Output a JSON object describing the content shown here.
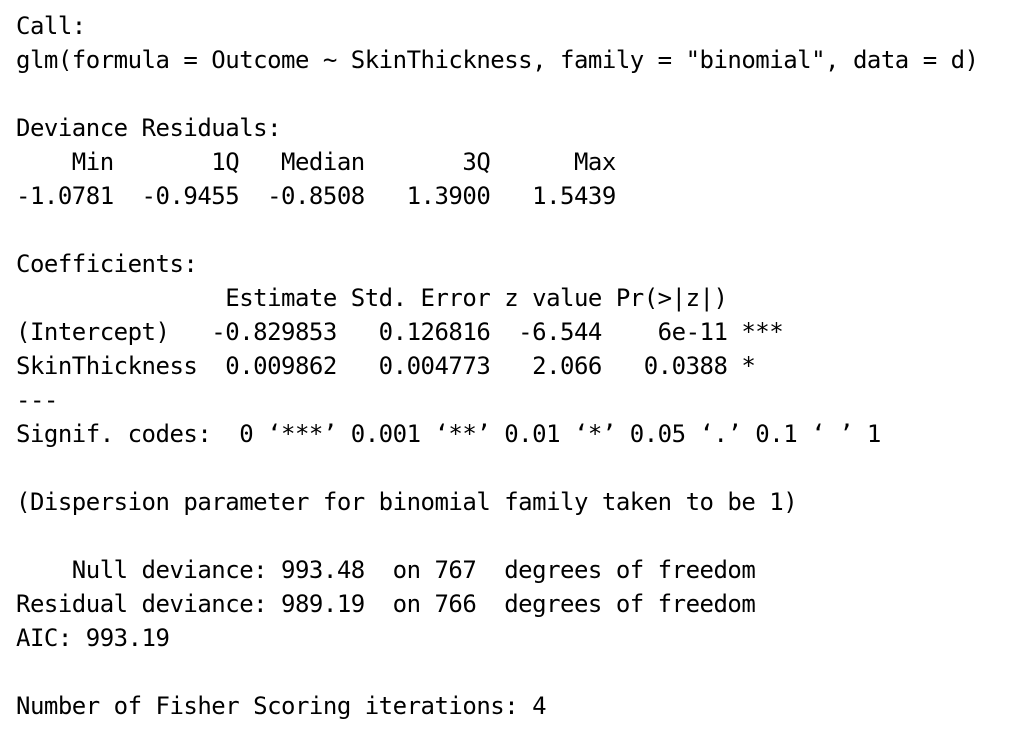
{
  "output_lines": [
    "Call:",
    "glm(formula = Outcome ~ SkinThickness, family = \"binomial\", data = d)",
    "",
    "Deviance Residuals:",
    "    Min       1Q   Median       3Q      Max  ",
    "-1.0781  -0.9455  -0.8508   1.3900   1.5439  ",
    "",
    "Coefficients:",
    "               Estimate Std. Error z value Pr(>|z|)    ",
    "(Intercept)   -0.829853   0.126816  -6.544    6e-11 ***",
    "SkinThickness  0.009862   0.004773   2.066   0.0388 *  ",
    "---",
    "Signif. codes:  0 ‘***’ 0.001 ‘**’ 0.01 ‘*’ 0.05 ‘.’ 0.1 ‘ ’ 1",
    "",
    "(Dispersion parameter for binomial family taken to be 1)",
    "",
    "    Null deviance: 993.48  on 767  degrees of freedom",
    "Residual deviance: 989.19  on 766  degrees of freedom",
    "AIC: 993.19",
    "",
    "Number of Fisher Scoring iterations: 4"
  ]
}
